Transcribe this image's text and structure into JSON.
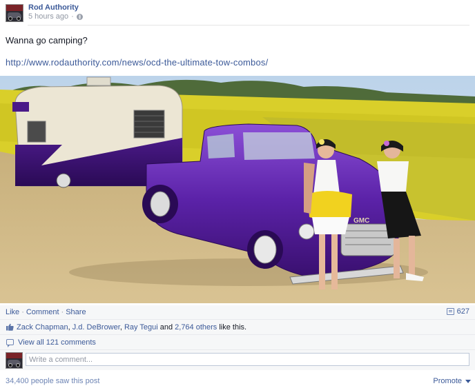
{
  "post": {
    "author": "Rod Authority",
    "timestamp": "5 hours ago",
    "message": "Wanna go camping?",
    "link": "http://www.rodauthority.com/news/ocd-the-ultimate-tow-combos/",
    "photo": {
      "truck_badge": "GMC"
    }
  },
  "actions": {
    "like": "Like",
    "comment": "Comment",
    "share": "Share",
    "separator": "·",
    "comment_count": "627"
  },
  "likes": {
    "names": [
      "Zack Chapman",
      "J.d. DeBrower",
      "Ray Tegui"
    ],
    "separator": ",",
    "conjunction": "and",
    "others": "2,764 others",
    "suffix": "like this."
  },
  "comments": {
    "view_all": "View all 121 comments"
  },
  "composer": {
    "placeholder": "Write a comment..."
  },
  "footer": {
    "seen": "34,400 people saw this post",
    "promote": "Promote"
  }
}
